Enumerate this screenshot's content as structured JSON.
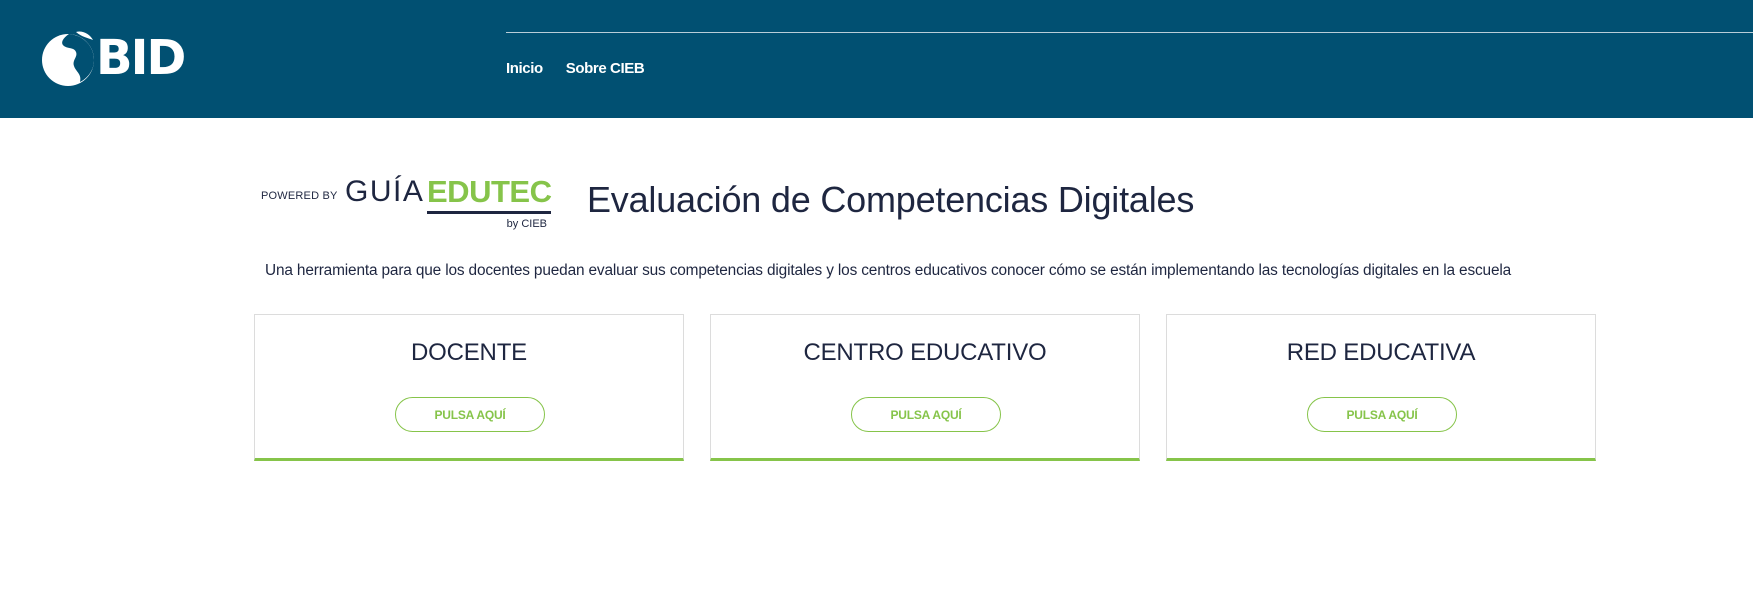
{
  "header": {
    "logo_text": "BID",
    "nav": [
      "Inicio",
      "Sobre CIEB"
    ]
  },
  "brand": {
    "powered_by": "POWERED BY",
    "guia": "GUÍA",
    "edutec": "EDUTEC",
    "by": "by CIEB"
  },
  "main": {
    "title": "Evaluación de Competencias Digitales",
    "subtitle": "Una herramienta para que los docentes puedan evaluar sus competencias digitales y los centros educativos conocer cómo se están implementando las tecnologías digitales en la escuela",
    "cards": [
      {
        "title": "DOCENTE",
        "button": "PULSA AQUÍ"
      },
      {
        "title": "CENTRO EDUCATIVO",
        "button": "PULSA AQUÍ"
      },
      {
        "title": "RED EDUCATIVA",
        "button": "PULSA AQUÍ"
      }
    ]
  },
  "colors": {
    "header_bg": "#015072",
    "accent_green": "#86c44a",
    "text_dark": "#1e2640"
  },
  "icons": {
    "logo": "americas-globe-icon"
  }
}
